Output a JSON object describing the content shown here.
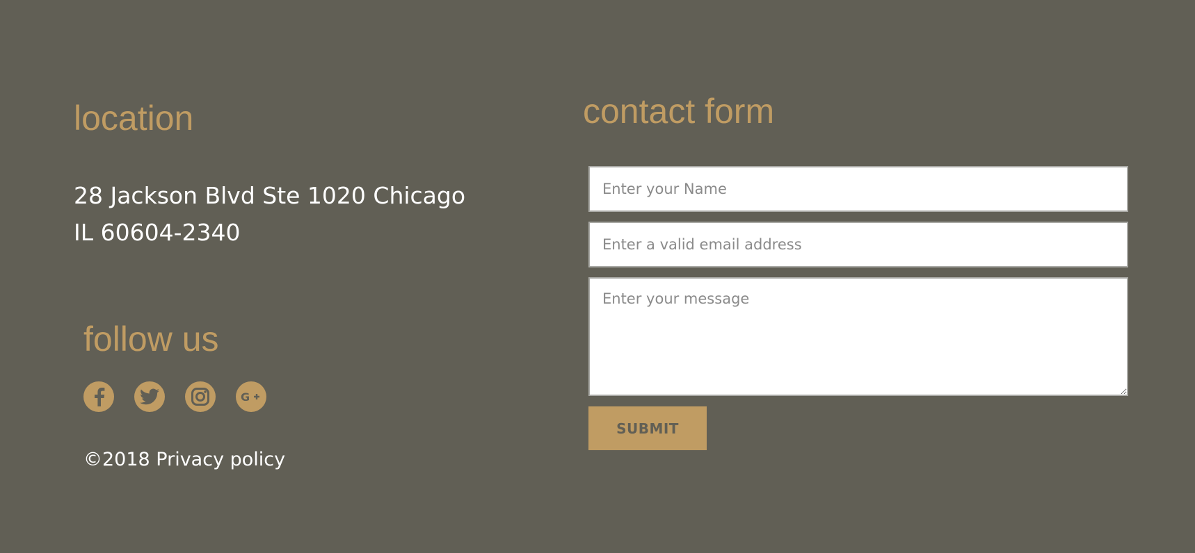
{
  "location": {
    "heading": "location",
    "address_line1": "28 Jackson Blvd Ste 1020 Chicago",
    "address_line2": "IL 60604-2340"
  },
  "follow": {
    "heading": "follow us",
    "social": [
      {
        "name": "facebook",
        "icon": "facebook-icon"
      },
      {
        "name": "twitter",
        "icon": "twitter-icon"
      },
      {
        "name": "instagram",
        "icon": "instagram-icon"
      },
      {
        "name": "google-plus",
        "icon": "google-plus-icon"
      }
    ]
  },
  "footer": {
    "copyright": "©2018 Privacy policy"
  },
  "contact": {
    "heading": "contact form",
    "name_placeholder": "Enter your Name",
    "email_placeholder": "Enter a valid email address",
    "message_placeholder": "Enter your message",
    "submit_label": "SUBMIT"
  },
  "colors": {
    "background": "#615f55",
    "accent": "#c09c63",
    "text": "#ffffff"
  }
}
